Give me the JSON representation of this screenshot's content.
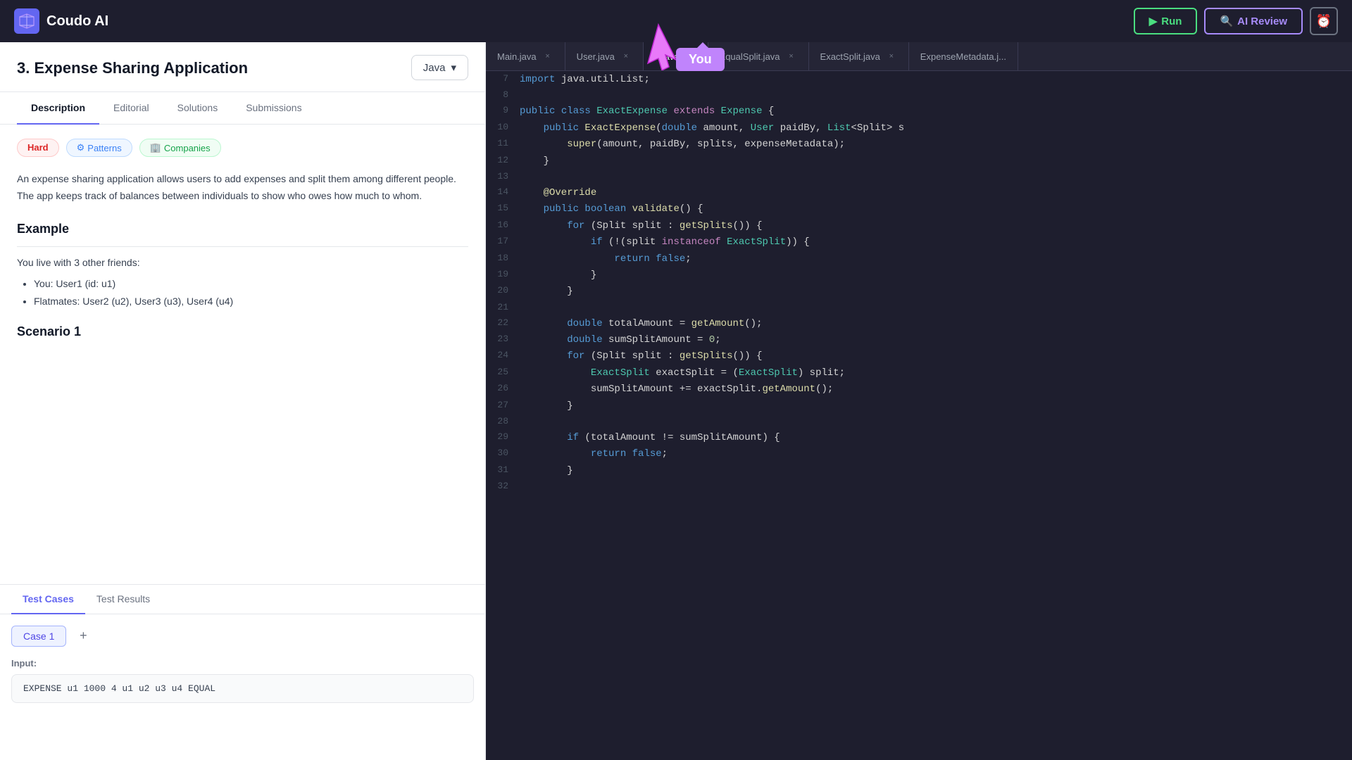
{
  "app": {
    "name": "Coudo AI"
  },
  "topbar": {
    "run_label": "Run",
    "ai_review_label": "AI Review",
    "clock_icon": "⏰",
    "play_icon": "▶",
    "search_icon": "🔍"
  },
  "you_tooltip": "You",
  "left_panel": {
    "problem_number": "3.",
    "problem_title": "Expense Sharing Application",
    "language": "Java",
    "nav_tabs": [
      {
        "label": "Description",
        "active": true
      },
      {
        "label": "Editorial",
        "active": false
      },
      {
        "label": "Solutions",
        "active": false
      },
      {
        "label": "Submissions",
        "active": false
      }
    ],
    "difficulty": "Hard",
    "tag_patterns": "Patterns",
    "tag_companies": "Companies",
    "description": "An expense sharing application allows users to add expenses and split them among different people. The app keeps track of balances between individuals to show who owes how much to whom.",
    "example_heading": "Example",
    "example_text": "You live with 3 other friends:",
    "bullet_you": "You: User1 (id: u1)",
    "bullet_flatmates": "Flatmates: User2 (u2), User3 (u3), User4 (u4)",
    "scenario_heading": "Scenario 1"
  },
  "test_panel": {
    "tab_test_cases": "Test Cases",
    "tab_test_results": "Test Results",
    "case_label": "Case 1",
    "add_case": "+",
    "input_label": "Input:",
    "input_value": "EXPENSE u1 1000 4 u1 u2 u3 u4 EQUAL"
  },
  "editor": {
    "tabs": [
      {
        "name": "Main.java",
        "active": false
      },
      {
        "name": "User.java",
        "active": false
      },
      {
        "name": "...java",
        "active": true
      },
      {
        "name": "EqualSplit.java",
        "active": false
      },
      {
        "name": "ExactSplit.java",
        "active": false
      },
      {
        "name": "ExpenseMetadata.j...",
        "active": false
      }
    ],
    "lines": [
      {
        "num": 7,
        "tokens": [
          {
            "t": "import ",
            "c": "kw"
          },
          {
            "t": "java.util.List",
            "c": ""
          },
          {
            "t": ";",
            "c": ""
          }
        ]
      },
      {
        "num": 8,
        "tokens": []
      },
      {
        "num": 9,
        "tokens": [
          {
            "t": "public ",
            "c": "kw"
          },
          {
            "t": "class ",
            "c": "kw"
          },
          {
            "t": "ExactExpense ",
            "c": "cls"
          },
          {
            "t": "extends ",
            "c": "kw2"
          },
          {
            "t": "Expense ",
            "c": "cls"
          },
          {
            "t": "{",
            "c": ""
          }
        ]
      },
      {
        "num": 10,
        "tokens": [
          {
            "t": "    public ",
            "c": "kw"
          },
          {
            "t": "ExactExpense",
            "c": "fn"
          },
          {
            "t": "(",
            "c": ""
          },
          {
            "t": "double ",
            "c": "kw"
          },
          {
            "t": "amount, ",
            "c": ""
          },
          {
            "t": "User ",
            "c": "cls"
          },
          {
            "t": "paidBy, ",
            "c": ""
          },
          {
            "t": "List",
            "c": "cls"
          },
          {
            "t": "<Split> s",
            "c": ""
          }
        ]
      },
      {
        "num": 11,
        "tokens": [
          {
            "t": "        super",
            "c": "fn"
          },
          {
            "t": "(amount, paidBy, splits, expenseMetadata);",
            "c": ""
          }
        ]
      },
      {
        "num": 12,
        "tokens": [
          {
            "t": "    }",
            "c": ""
          }
        ]
      },
      {
        "num": 13,
        "tokens": []
      },
      {
        "num": 14,
        "tokens": [
          {
            "t": "    @Override",
            "c": "ann"
          }
        ]
      },
      {
        "num": 15,
        "tokens": [
          {
            "t": "    public ",
            "c": "kw"
          },
          {
            "t": "boolean ",
            "c": "kw"
          },
          {
            "t": "validate",
            "c": "fn"
          },
          {
            "t": "() {",
            "c": ""
          }
        ]
      },
      {
        "num": 16,
        "tokens": [
          {
            "t": "        for ",
            "c": "kw"
          },
          {
            "t": "(Split split : ",
            "c": ""
          },
          {
            "t": "getSplits",
            "c": "fn"
          },
          {
            "t": "()) {",
            "c": ""
          }
        ]
      },
      {
        "num": 17,
        "tokens": [
          {
            "t": "            if ",
            "c": "kw"
          },
          {
            "t": "(!(split ",
            "c": ""
          },
          {
            "t": "instanceof ",
            "c": "kw2"
          },
          {
            "t": "ExactSplit",
            "c": "cls"
          },
          {
            "t": ")) {",
            "c": ""
          }
        ]
      },
      {
        "num": 18,
        "tokens": [
          {
            "t": "                return ",
            "c": "kw"
          },
          {
            "t": "false",
            "c": "bool"
          },
          {
            "t": ";",
            "c": ""
          }
        ]
      },
      {
        "num": 19,
        "tokens": [
          {
            "t": "            }",
            "c": ""
          }
        ]
      },
      {
        "num": 20,
        "tokens": [
          {
            "t": "        }",
            "c": ""
          }
        ]
      },
      {
        "num": 21,
        "tokens": []
      },
      {
        "num": 22,
        "tokens": [
          {
            "t": "        double ",
            "c": "kw"
          },
          {
            "t": "totalAmount = ",
            "c": ""
          },
          {
            "t": "getAmount",
            "c": "fn"
          },
          {
            "t": "();",
            "c": ""
          }
        ]
      },
      {
        "num": 23,
        "tokens": [
          {
            "t": "        double ",
            "c": "kw"
          },
          {
            "t": "sumSplitAmount = ",
            "c": ""
          },
          {
            "t": "0",
            "c": "num"
          },
          {
            "t": ";",
            "c": ""
          }
        ]
      },
      {
        "num": 24,
        "tokens": [
          {
            "t": "        for ",
            "c": "kw"
          },
          {
            "t": "(Split split : ",
            "c": ""
          },
          {
            "t": "getSplits",
            "c": "fn"
          },
          {
            "t": "()) {",
            "c": ""
          }
        ]
      },
      {
        "num": 25,
        "tokens": [
          {
            "t": "            ExactSplit ",
            "c": "cls"
          },
          {
            "t": "exactSplit = (",
            "c": ""
          },
          {
            "t": "ExactSplit",
            "c": "cls"
          },
          {
            "t": ") split;",
            "c": ""
          }
        ]
      },
      {
        "num": 26,
        "tokens": [
          {
            "t": "            sumSplitAmount += exactSplit.",
            "c": ""
          },
          {
            "t": "getAmount",
            "c": "fn"
          },
          {
            "t": "();",
            "c": ""
          }
        ]
      },
      {
        "num": 27,
        "tokens": [
          {
            "t": "        }",
            "c": ""
          }
        ]
      },
      {
        "num": 28,
        "tokens": []
      },
      {
        "num": 29,
        "tokens": [
          {
            "t": "        if ",
            "c": "kw"
          },
          {
            "t": "(totalAmount != sumSplitAmount) {",
            "c": ""
          }
        ]
      },
      {
        "num": 30,
        "tokens": [
          {
            "t": "            return ",
            "c": "kw"
          },
          {
            "t": "false",
            "c": "bool"
          },
          {
            "t": ";",
            "c": ""
          }
        ]
      },
      {
        "num": 31,
        "tokens": [
          {
            "t": "        }",
            "c": ""
          }
        ]
      },
      {
        "num": 32,
        "tokens": []
      }
    ]
  }
}
